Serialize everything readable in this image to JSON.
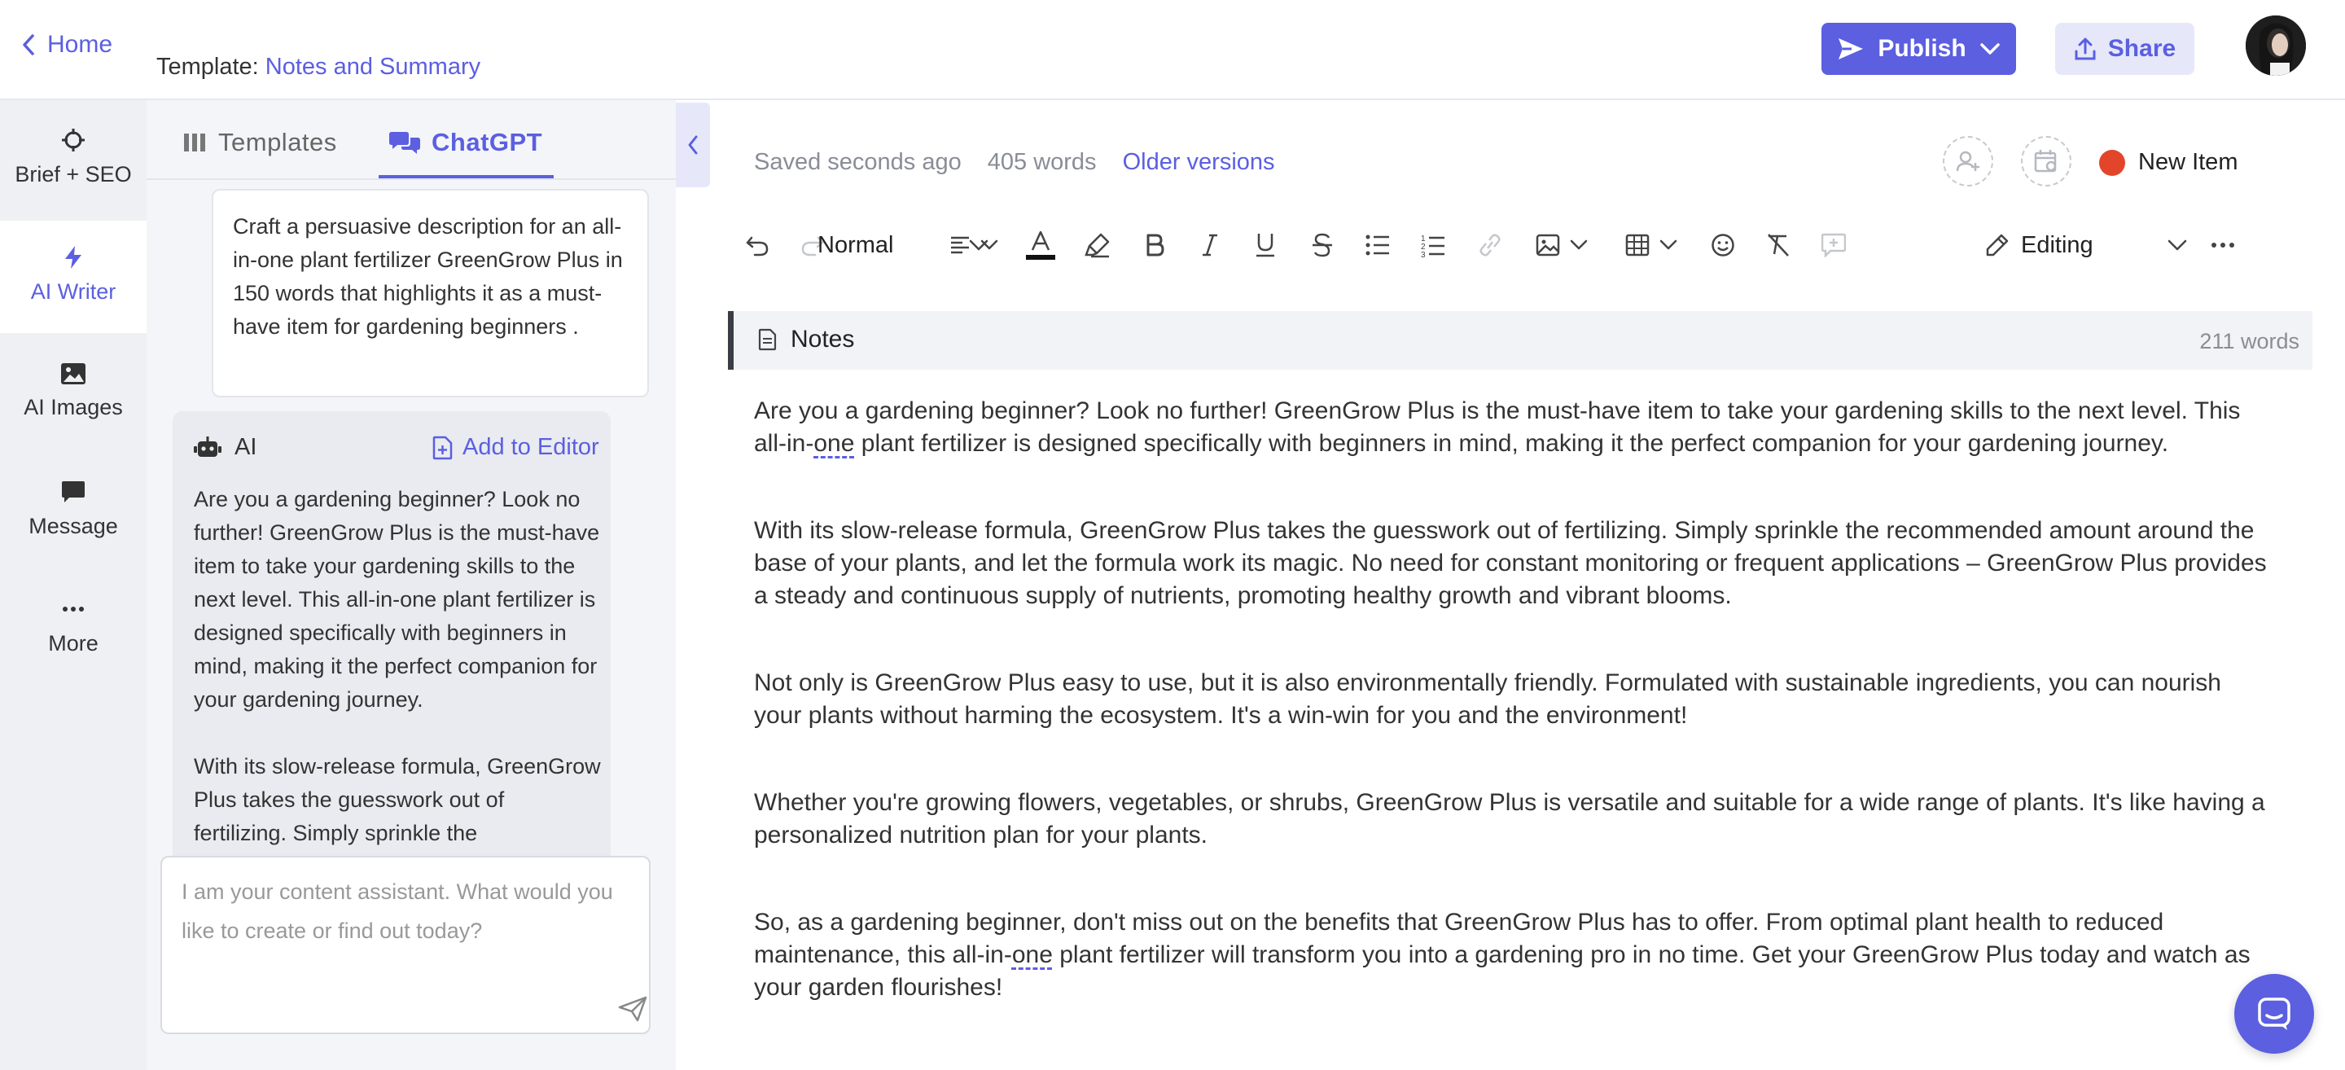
{
  "header": {
    "home_label": "Home",
    "template_prefix": "Template:",
    "template_name": "Notes and Summary",
    "publish_label": "Publish",
    "share_label": "Share"
  },
  "rail": {
    "items": [
      {
        "label": "Brief + SEO",
        "icon": "crosshair-icon"
      },
      {
        "label": "AI Writer",
        "icon": "lightning-icon",
        "active": true
      },
      {
        "label": "AI Images",
        "icon": "image-icon"
      },
      {
        "label": "Message",
        "icon": "message-icon"
      },
      {
        "label": "More",
        "icon": "more-icon"
      }
    ]
  },
  "chat": {
    "tabs": [
      {
        "label": "Templates",
        "icon": "templates-icon"
      },
      {
        "label": "ChatGPT",
        "icon": "chat-icon",
        "active": true
      }
    ],
    "prompt": "Craft a persuasive description for an all-in-one plant fertilizer GreenGrow Plus in 150 words that highlights it as a must-have item for gardening beginners .",
    "ai_label": "AI",
    "add_to_editor": "Add to Editor",
    "ai_response": "Are you a gardening beginner? Look no further! GreenGrow Plus is the must-have item to take your gardening skills to the next level. This all-in-one plant fertilizer is designed specifically with beginners in mind, making it the perfect companion for your gardening journey.\n\nWith its slow-release formula, GreenGrow Plus takes the guesswork out of fertilizing. Simply sprinkle the",
    "input_placeholder": "I am your content assistant. What would you like to create or find out today?"
  },
  "editor": {
    "saved_status": "Saved seconds ago",
    "word_count": "405 words",
    "older_versions": "Older versions",
    "new_item_label": "New Item",
    "new_item_color": "#e2452a",
    "toolbar": {
      "style_value": "Normal",
      "mode_value": "Editing"
    },
    "section": {
      "title": "Notes",
      "word_count": "211 words"
    },
    "paragraphs": {
      "p1_a": "Are you a gardening beginner? Look no further! GreenGrow Plus is the must-have item to take your gardening skills to the next level. This all-in-",
      "p1_b": "one",
      "p1_c": " plant fertilizer is designed specifically with beginners in mind, making it the perfect companion for your gardening journey.",
      "p2": "With its slow-release formula, GreenGrow Plus takes the guesswork out of fertilizing. Simply sprinkle the recommended amount around the base of your plants, and let the formula work its magic. No need for constant monitoring or frequent applications – GreenGrow Plus provides a steady and continuous supply of nutrients, promoting healthy growth and vibrant blooms.",
      "p3": "Not only is GreenGrow Plus easy to use, but it is also environmentally friendly. Formulated with sustainable ingredients, you can nourish your plants without harming the ecosystem. It's a win-win for you and the environment!",
      "p4": "Whether you're growing flowers, vegetables, or shrubs, GreenGrow Plus is versatile and suitable for a wide range of plants. It's like having a personalized nutrition plan for your plants.",
      "p5_a": "So, as a gardening beginner, don't miss out on the benefits that GreenGrow Plus has to offer. From optimal plant health to reduced maintenance, this all-in-",
      "p5_b": "one",
      "p5_c": " plant fertilizer will transform you into a gardening pro in no time. Get your GreenGrow Plus today and watch as your garden flourishes!"
    }
  },
  "colors": {
    "accent": "#5b5fe0",
    "accent_light": "#e6e8fa",
    "rail_bg": "#eef0f4"
  }
}
